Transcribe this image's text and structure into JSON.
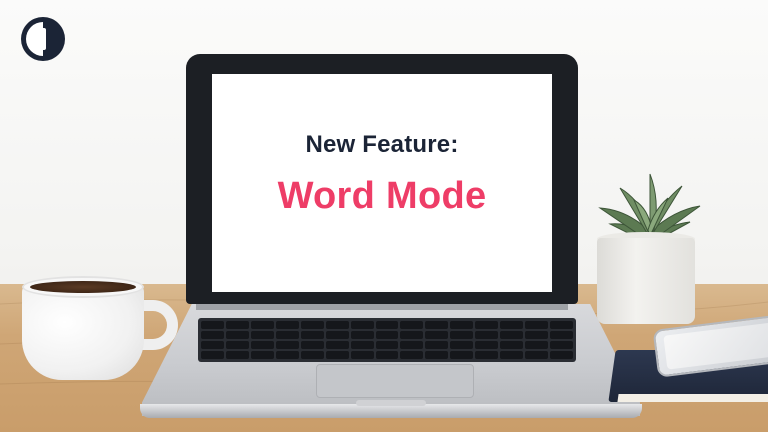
{
  "screen": {
    "headline": "New Feature:",
    "feature_name": "Word Mode"
  },
  "colors": {
    "headline": "#1b2436",
    "feature_name": "#ee3d67",
    "logo": "#1b2436"
  },
  "objects": [
    "brand-logo",
    "laptop",
    "coffee-mug",
    "succulent-plant",
    "notebook",
    "smartphone"
  ]
}
